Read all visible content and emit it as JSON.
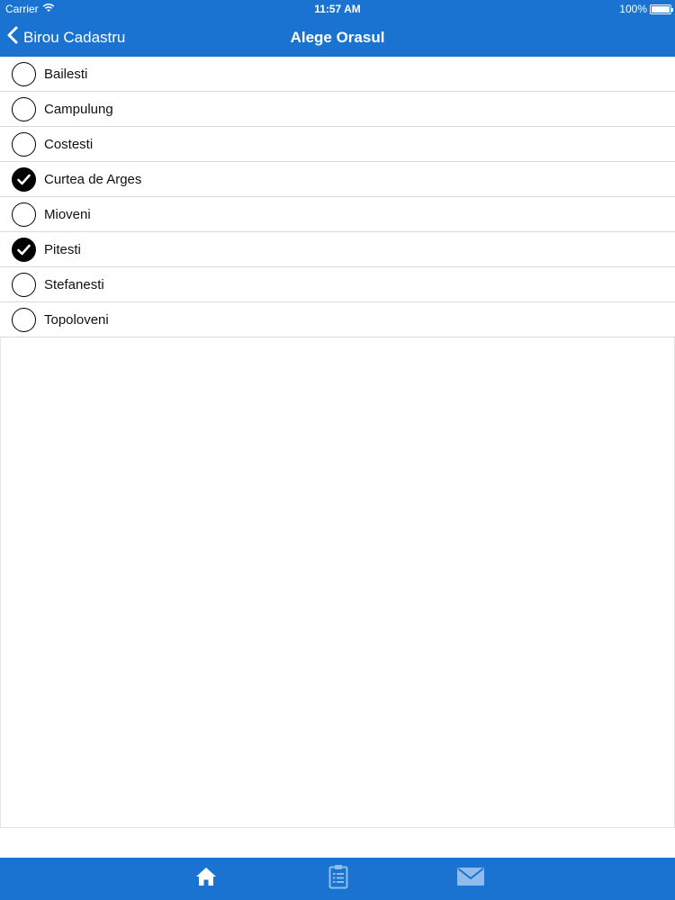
{
  "status_bar": {
    "carrier": "Carrier",
    "time": "11:57 AM",
    "battery": "100%"
  },
  "nav": {
    "back_label": "Birou Cadastru",
    "title": "Alege Orasul"
  },
  "cities": [
    {
      "label": "Bailesti",
      "checked": false
    },
    {
      "label": "Campulung",
      "checked": false
    },
    {
      "label": "Costesti",
      "checked": false
    },
    {
      "label": "Curtea de Arges",
      "checked": true
    },
    {
      "label": "Mioveni",
      "checked": false
    },
    {
      "label": "Pitesti",
      "checked": true
    },
    {
      "label": "Stefanesti",
      "checked": false
    },
    {
      "label": "Topoloveni",
      "checked": false
    }
  ],
  "tabs": [
    {
      "icon": "home-icon",
      "active": true
    },
    {
      "icon": "clipboard-icon",
      "active": false
    },
    {
      "icon": "mail-icon",
      "active": false
    }
  ],
  "colors": {
    "accent": "#1a73d0",
    "tab_inactive": "#8fbcec"
  }
}
